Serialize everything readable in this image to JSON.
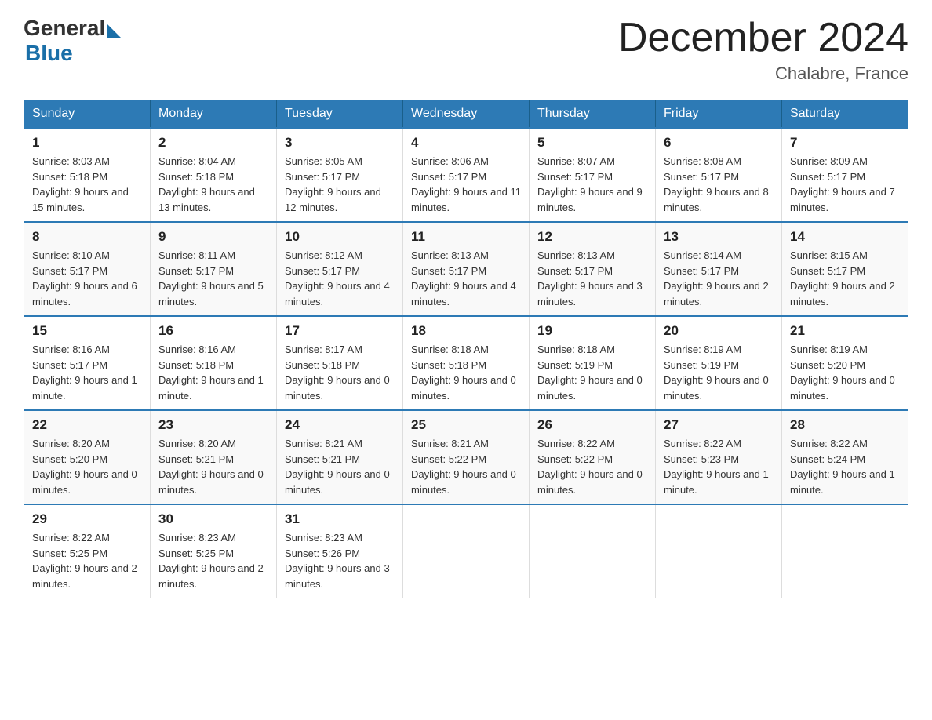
{
  "header": {
    "logo_general": "General",
    "logo_blue": "Blue",
    "title": "December 2024",
    "subtitle": "Chalabre, France"
  },
  "days_of_week": [
    "Sunday",
    "Monday",
    "Tuesday",
    "Wednesday",
    "Thursday",
    "Friday",
    "Saturday"
  ],
  "weeks": [
    [
      {
        "day": "1",
        "sunrise": "8:03 AM",
        "sunset": "5:18 PM",
        "daylight": "9 hours and 15 minutes."
      },
      {
        "day": "2",
        "sunrise": "8:04 AM",
        "sunset": "5:18 PM",
        "daylight": "9 hours and 13 minutes."
      },
      {
        "day": "3",
        "sunrise": "8:05 AM",
        "sunset": "5:17 PM",
        "daylight": "9 hours and 12 minutes."
      },
      {
        "day": "4",
        "sunrise": "8:06 AM",
        "sunset": "5:17 PM",
        "daylight": "9 hours and 11 minutes."
      },
      {
        "day": "5",
        "sunrise": "8:07 AM",
        "sunset": "5:17 PM",
        "daylight": "9 hours and 9 minutes."
      },
      {
        "day": "6",
        "sunrise": "8:08 AM",
        "sunset": "5:17 PM",
        "daylight": "9 hours and 8 minutes."
      },
      {
        "day": "7",
        "sunrise": "8:09 AM",
        "sunset": "5:17 PM",
        "daylight": "9 hours and 7 minutes."
      }
    ],
    [
      {
        "day": "8",
        "sunrise": "8:10 AM",
        "sunset": "5:17 PM",
        "daylight": "9 hours and 6 minutes."
      },
      {
        "day": "9",
        "sunrise": "8:11 AM",
        "sunset": "5:17 PM",
        "daylight": "9 hours and 5 minutes."
      },
      {
        "day": "10",
        "sunrise": "8:12 AM",
        "sunset": "5:17 PM",
        "daylight": "9 hours and 4 minutes."
      },
      {
        "day": "11",
        "sunrise": "8:13 AM",
        "sunset": "5:17 PM",
        "daylight": "9 hours and 4 minutes."
      },
      {
        "day": "12",
        "sunrise": "8:13 AM",
        "sunset": "5:17 PM",
        "daylight": "9 hours and 3 minutes."
      },
      {
        "day": "13",
        "sunrise": "8:14 AM",
        "sunset": "5:17 PM",
        "daylight": "9 hours and 2 minutes."
      },
      {
        "day": "14",
        "sunrise": "8:15 AM",
        "sunset": "5:17 PM",
        "daylight": "9 hours and 2 minutes."
      }
    ],
    [
      {
        "day": "15",
        "sunrise": "8:16 AM",
        "sunset": "5:17 PM",
        "daylight": "9 hours and 1 minute."
      },
      {
        "day": "16",
        "sunrise": "8:16 AM",
        "sunset": "5:18 PM",
        "daylight": "9 hours and 1 minute."
      },
      {
        "day": "17",
        "sunrise": "8:17 AM",
        "sunset": "5:18 PM",
        "daylight": "9 hours and 0 minutes."
      },
      {
        "day": "18",
        "sunrise": "8:18 AM",
        "sunset": "5:18 PM",
        "daylight": "9 hours and 0 minutes."
      },
      {
        "day": "19",
        "sunrise": "8:18 AM",
        "sunset": "5:19 PM",
        "daylight": "9 hours and 0 minutes."
      },
      {
        "day": "20",
        "sunrise": "8:19 AM",
        "sunset": "5:19 PM",
        "daylight": "9 hours and 0 minutes."
      },
      {
        "day": "21",
        "sunrise": "8:19 AM",
        "sunset": "5:20 PM",
        "daylight": "9 hours and 0 minutes."
      }
    ],
    [
      {
        "day": "22",
        "sunrise": "8:20 AM",
        "sunset": "5:20 PM",
        "daylight": "9 hours and 0 minutes."
      },
      {
        "day": "23",
        "sunrise": "8:20 AM",
        "sunset": "5:21 PM",
        "daylight": "9 hours and 0 minutes."
      },
      {
        "day": "24",
        "sunrise": "8:21 AM",
        "sunset": "5:21 PM",
        "daylight": "9 hours and 0 minutes."
      },
      {
        "day": "25",
        "sunrise": "8:21 AM",
        "sunset": "5:22 PM",
        "daylight": "9 hours and 0 minutes."
      },
      {
        "day": "26",
        "sunrise": "8:22 AM",
        "sunset": "5:22 PM",
        "daylight": "9 hours and 0 minutes."
      },
      {
        "day": "27",
        "sunrise": "8:22 AM",
        "sunset": "5:23 PM",
        "daylight": "9 hours and 1 minute."
      },
      {
        "day": "28",
        "sunrise": "8:22 AM",
        "sunset": "5:24 PM",
        "daylight": "9 hours and 1 minute."
      }
    ],
    [
      {
        "day": "29",
        "sunrise": "8:22 AM",
        "sunset": "5:25 PM",
        "daylight": "9 hours and 2 minutes."
      },
      {
        "day": "30",
        "sunrise": "8:23 AM",
        "sunset": "5:25 PM",
        "daylight": "9 hours and 2 minutes."
      },
      {
        "day": "31",
        "sunrise": "8:23 AM",
        "sunset": "5:26 PM",
        "daylight": "9 hours and 3 minutes."
      },
      null,
      null,
      null,
      null
    ]
  ],
  "labels": {
    "sunrise_prefix": "Sunrise: ",
    "sunset_prefix": "Sunset: ",
    "daylight_prefix": "Daylight: "
  }
}
